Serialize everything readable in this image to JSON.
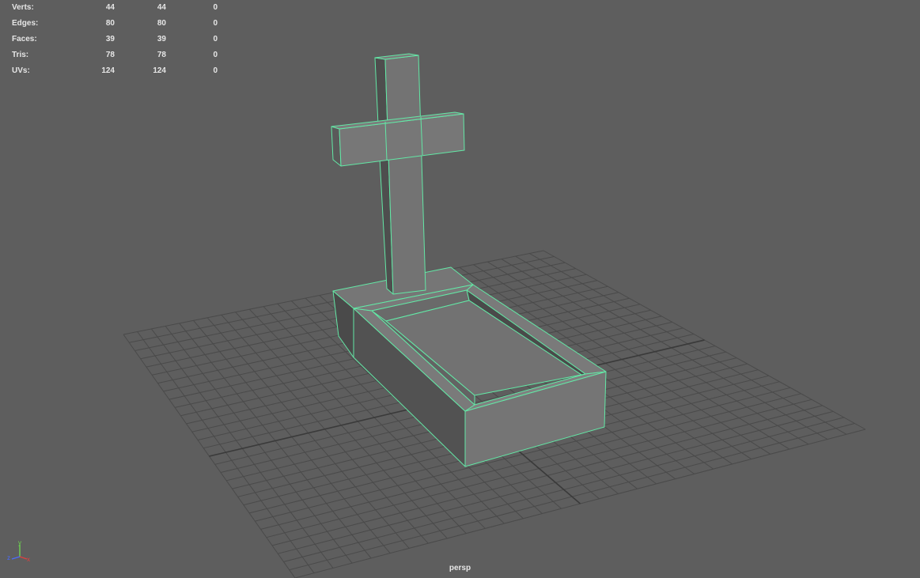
{
  "hud": {
    "rows": [
      {
        "label": "Verts:",
        "v1": "44",
        "v2": "44",
        "v3": "0"
      },
      {
        "label": "Edges:",
        "v1": "80",
        "v2": "80",
        "v3": "0"
      },
      {
        "label": "Faces:",
        "v1": "39",
        "v2": "39",
        "v3": "0"
      },
      {
        "label": "Tris:",
        "v1": "78",
        "v2": "78",
        "v3": "0"
      },
      {
        "label": "UVs:",
        "v1": "124",
        "v2": "124",
        "v3": "0"
      }
    ]
  },
  "viewport": {
    "camera": "persp",
    "background_color": "#5e5e5e",
    "selection_color": "#5dffb0",
    "object": "tombstone-with-cross"
  },
  "axis_gizmo": {
    "x": "x",
    "y": "y",
    "z": "z"
  }
}
